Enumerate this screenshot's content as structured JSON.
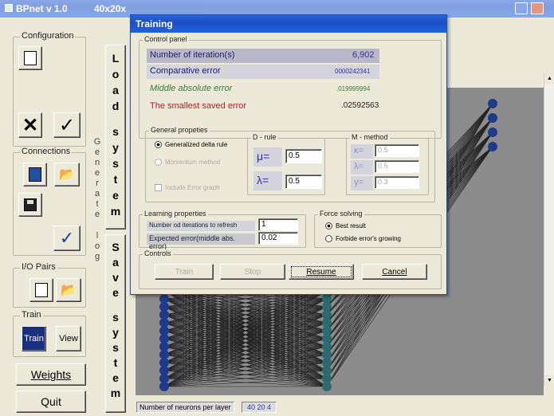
{
  "main_window": {
    "title": "BPnet v 1.0",
    "title_extra": "40x20x"
  },
  "sidebar": {
    "configuration_label": "Configuration",
    "connections_label": "Connections",
    "io_pairs_label": "I/O Pairs",
    "train_label": "Train",
    "train_button": "Train",
    "view_button": "View",
    "weights_button": "Weights",
    "quit_button": "Quit"
  },
  "vertical": {
    "load_system": [
      "L",
      "o",
      "a",
      "d",
      "",
      "s",
      "y",
      "s",
      "t",
      "e",
      "m"
    ],
    "generate": [
      "G",
      "e",
      "n",
      "e",
      "r",
      "a",
      "t",
      "e"
    ],
    "log": [
      "l",
      "o",
      "g"
    ],
    "save_system": [
      "S",
      "a",
      "v",
      "e",
      "",
      "s",
      "y",
      "s",
      "t",
      "e",
      "m"
    ]
  },
  "status": {
    "neurons_label": "Number of neurons per layer",
    "neurons_value": "40 20 4"
  },
  "dialog": {
    "title": "Training",
    "control_panel_label": "Control panel",
    "iterations_label": "Number of iteration(s)",
    "iterations_value": "6,902",
    "comparative_label": "Comparative error",
    "comparative_value": "0000242341",
    "middle_label": "Middle absolute error",
    "middle_value": ".019999994",
    "smallest_label": "The smallest saved error",
    "smallest_value": ".02592563",
    "general_label": "General propeties",
    "gen_delta": "Generalized delta rule",
    "gen_momentum": "Momentum method",
    "include_error": "Include Error graph",
    "drule_label": "D - rule",
    "mu_symbol": "μ=",
    "mu_value": "0.5",
    "lambda_symbol": "λ=",
    "lambda_value": "0.5",
    "mmethod_label": "M - method",
    "m_kappa": "κ=",
    "m_kappa_value": "0.5",
    "m_lambda": "λ=",
    "m_lambda_value": "0.5",
    "m_gamma": "γ=",
    "m_gamma_value": "0.3",
    "learning_label": "Learning properties",
    "refresh_label": "Number od iterations to refresh",
    "refresh_value": "1",
    "expected_label": "Expected error(middle abs. error)",
    "expected_value": "0.02",
    "force_label": "Force solving",
    "force_best": "Best result",
    "force_forbid": "Forbide error's growing",
    "controls_label": "Controls",
    "btn_train": "Train",
    "btn_stop": "Stop",
    "btn_resume": "Resume",
    "btn_cancel": "Cancel"
  },
  "colors": {
    "titlebar": "#2160dc",
    "network_bg": "#8c8c8c",
    "node": "#1e3a8a",
    "smallest_error": "#b02020",
    "middle_error": "#3a7a3a",
    "values_blue": "#3030a0"
  }
}
